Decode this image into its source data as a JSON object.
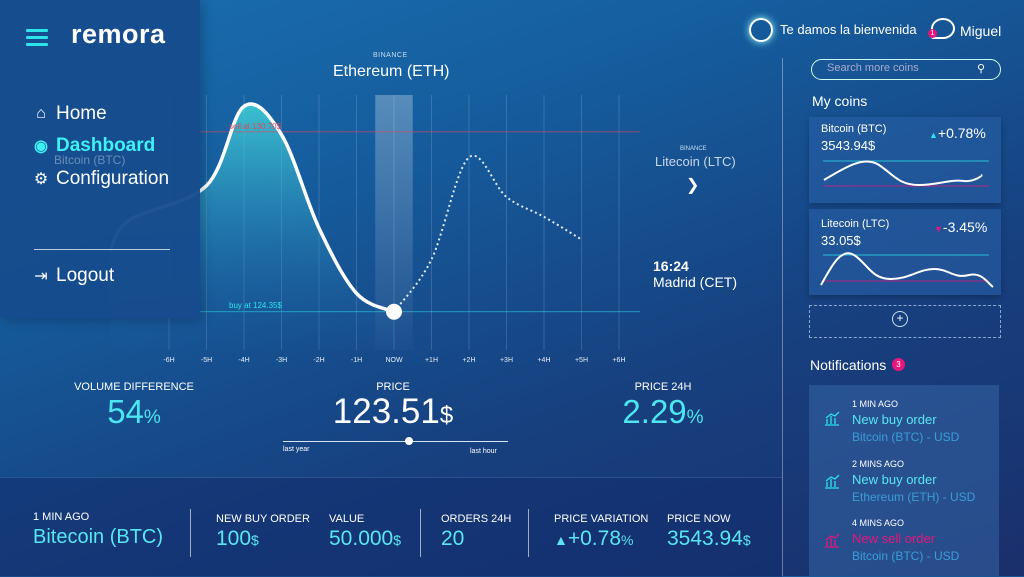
{
  "header": {
    "welcome": "Te damos la bienvenida",
    "user_name": "Miguel",
    "user_badge": "1"
  },
  "menu": {
    "brand": "remora",
    "items": [
      {
        "label": "Home",
        "icon": "home-icon"
      },
      {
        "label": "Dashboard",
        "icon": "eye-icon",
        "active": true
      },
      {
        "label": "Configuration",
        "icon": "gear-icon"
      }
    ],
    "logout": "Logout"
  },
  "chart": {
    "source": "BINANCE",
    "title": "Ethereum (ETH)",
    "prev_coin": "Bitcoin (BTC)",
    "next_source": "BINANCE",
    "next_coin": "Litecoin (LTC)",
    "buy_label": "buy at 124.35$",
    "sell_label": "sell at 130.70$",
    "time": "16:24",
    "city": "Madrid (CET)"
  },
  "chart_data": {
    "type": "line",
    "title": "Ethereum (ETH)",
    "x": [
      "-6H",
      "-5H",
      "-4H",
      "-3H",
      "-2H",
      "-1H",
      "NOW",
      "+1H",
      "+2H",
      "+3H",
      "+4H",
      "+5H",
      "+6H"
    ],
    "series": [
      {
        "values": [
          null,
          128.8,
          131.6,
          130.6,
          127.3,
          125.0,
          124.35,
          null,
          null,
          null,
          null,
          null,
          null
        ]
      },
      {
        "values": [
          null,
          null,
          null,
          null,
          null,
          null,
          124.35,
          126.2,
          129.8,
          128.4,
          127.7,
          126.9,
          null
        ]
      }
    ],
    "hlines": [
      {
        "label": "buy at 124.35$",
        "value": 124.35,
        "color": "#2be3ea"
      },
      {
        "label": "sell at 130.70$",
        "value": 130.7,
        "color": "#e04a5a"
      }
    ],
    "ylim": [
      123,
      132
    ]
  },
  "metrics": {
    "volume_label": "VOLUME DIFFERENCE",
    "volume_value": "54",
    "volume_unit": "%",
    "price_label": "PRICE",
    "price_value": "123.51",
    "price_unit": "$",
    "price24_label": "PRICE 24H",
    "price24_value": "2.29",
    "price24_unit": "%",
    "slider_left": "last year",
    "slider_right": "last hour",
    "slider_value": 0.56
  },
  "bottom": {
    "time_label": "1 MIN AGO",
    "coin": "Bitecoin (BTC)",
    "new_buy_label": "NEW BUY ORDER",
    "new_buy_value": "100",
    "new_buy_unit": "$",
    "value_label": "VALUE",
    "value_value": "50.000",
    "value_unit": "$",
    "orders_label": "ORDERS 24H",
    "orders_value": "20",
    "variation_label": "PRICE VARIATION",
    "variation_value": "+0.78",
    "variation_unit": "%",
    "now_label": "PRICE NOW",
    "now_value": "3543.94",
    "now_unit": "$"
  },
  "sidebar": {
    "search_placeholder": "Search more coins",
    "my_coins": "My coins",
    "coins": [
      {
        "name": "Bitcoin (BTC)",
        "price": "3543.94$",
        "change": "+0.78%",
        "direction": "up"
      },
      {
        "name": "Litecoin (LTC)",
        "price": "33.05$",
        "change": "-3.45%",
        "direction": "down"
      }
    ],
    "notifications_title": "Notifications",
    "notifications_count": "3",
    "notifications": [
      {
        "time": "1 MIN AGO",
        "title": "New buy order",
        "sub": "Bitcoin (BTC) - USD",
        "kind": "buy"
      },
      {
        "time": "2 MINS AGO",
        "title": "New buy order",
        "sub": "Ethereum (ETH) - USD",
        "kind": "buy"
      },
      {
        "time": "4 MINS AGO",
        "title": "New sell order",
        "sub": "Bitcoin (BTC) - USD",
        "kind": "sell"
      }
    ]
  },
  "colors": {
    "accent": "#2be3ea",
    "sell": "#e5177d",
    "down": "#e04a5a"
  }
}
